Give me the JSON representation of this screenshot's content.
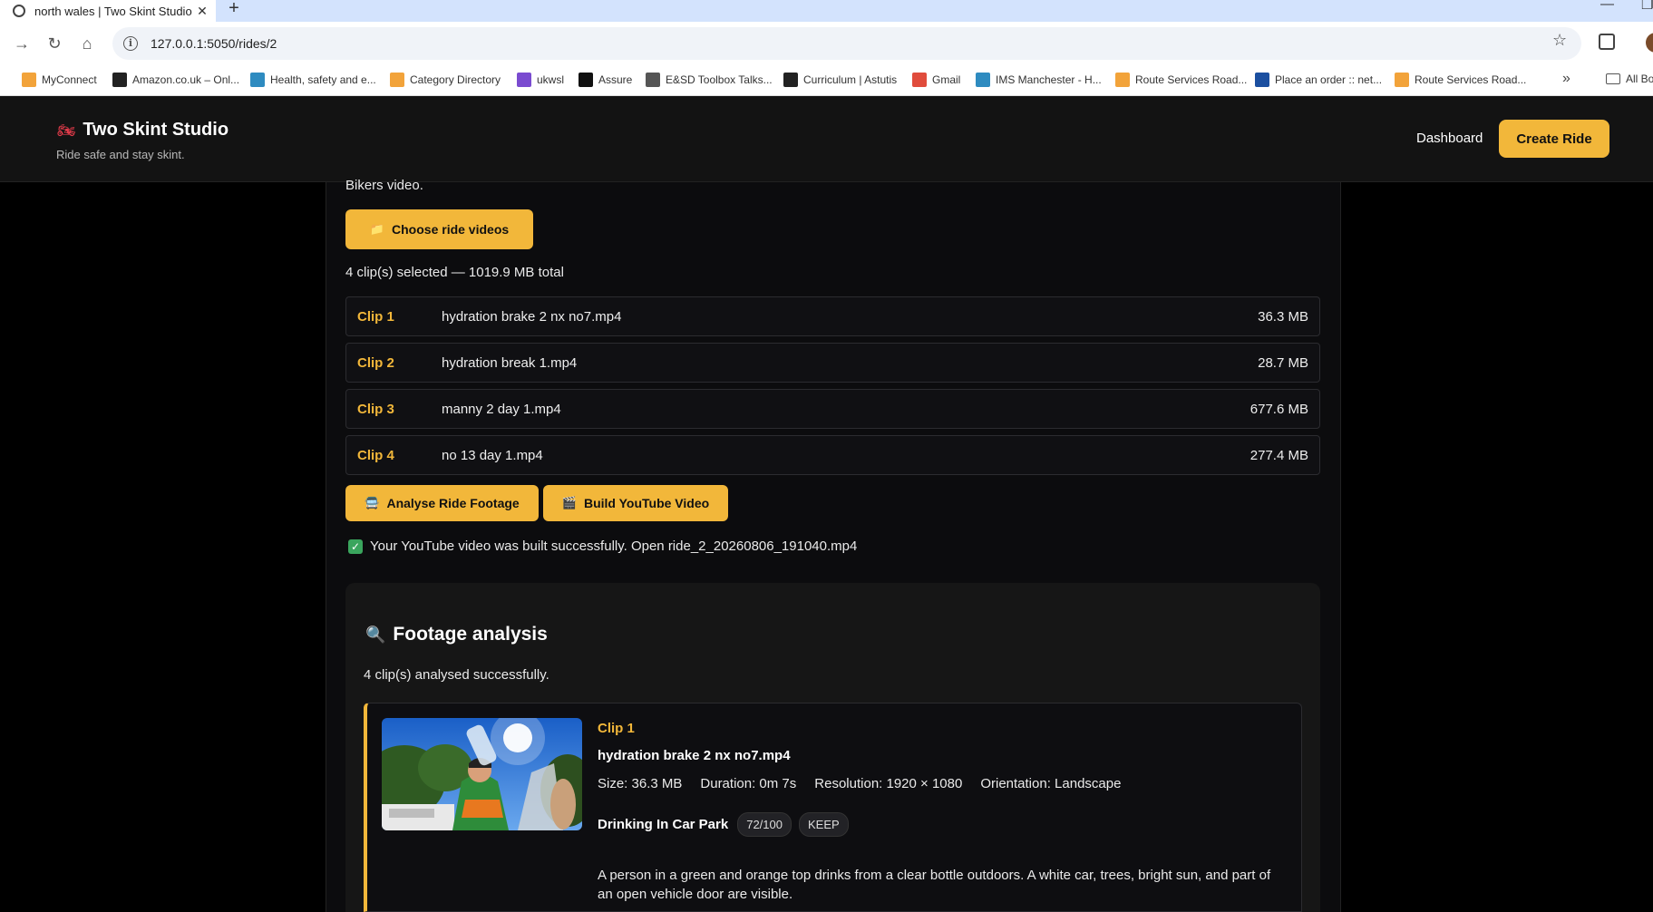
{
  "browser": {
    "tab_title": "north wales | Two Skint Studio",
    "url": "127.0.0.1:5050/rides/2",
    "bookmarks": [
      {
        "label": "MyConnect",
        "color": "#f2a33a"
      },
      {
        "label": "Amazon.co.uk – Onl...",
        "color": "#222222"
      },
      {
        "label": "Health, safety and e...",
        "color": "#2e8bc0"
      },
      {
        "label": "Category Directory",
        "color": "#f2a33a"
      },
      {
        "label": "ukwsl",
        "color": "#7a4bd0"
      },
      {
        "label": "Assure",
        "color": "#111111"
      },
      {
        "label": "E&SD Toolbox Talks...",
        "color": "#555555"
      },
      {
        "label": "Curriculum | Astutis",
        "color": "#222222"
      },
      {
        "label": "Gmail",
        "color": "#e04c3c"
      },
      {
        "label": "IMS Manchester - H...",
        "color": "#2e8bc0"
      },
      {
        "label": "Route Services Road...",
        "color": "#f2a33a"
      },
      {
        "label": "Place an order :: net...",
        "color": "#1b4fa0"
      },
      {
        "label": "Route Services Road...",
        "color": "#f2a33a"
      }
    ],
    "more_label": "»",
    "all_bookmarks_label": "All Bo"
  },
  "app": {
    "brand_icon": "🏍",
    "title": "Two Skint Studio",
    "tagline": "Ride safe and stay skint.",
    "nav_dashboard": "Dashboard",
    "create_ride": "Create Ride"
  },
  "upload": {
    "cut_text": "Bikers video.",
    "choose_emoji": "📁",
    "choose_label": "Choose ride videos",
    "summary": "4 clip(s) selected — 1019.9 MB total",
    "clips": [
      {
        "label": "Clip 1",
        "name": "hydration brake 2 nx no7.mp4",
        "size": "36.3 MB"
      },
      {
        "label": "Clip 2",
        "name": "hydration break 1.mp4",
        "size": "28.7 MB"
      },
      {
        "label": "Clip 3",
        "name": "manny 2 day 1.mp4",
        "size": "677.6 MB"
      },
      {
        "label": "Clip 4",
        "name": "no 13 day 1.mp4",
        "size": "277.4 MB"
      }
    ],
    "analyse_emoji": "🚍",
    "analyse_label": "Analyse Ride Footage",
    "build_emoji": "🎬",
    "build_label": "Build YouTube Video",
    "success_check": "✓",
    "success_text": "Your YouTube video was built successfully. Open ride_2_20260806_191040.mp4"
  },
  "analysis": {
    "icon": "🔍",
    "title": "Footage analysis",
    "summary": "4 clip(s) analysed successfully.",
    "card": {
      "clip_label": "Clip 1",
      "file": "hydration brake 2 nx no7.mp4",
      "size": "Size: 36.3 MB",
      "duration": "Duration: 0m 7s",
      "resolution": "Resolution: 1920 × 1080",
      "orientation": "Orientation: Landscape",
      "scene": "Drinking In Car Park",
      "score": "72/100",
      "verdict": "KEEP",
      "description": "A person in a green and orange top drinks from a clear bottle outdoors. A white car, trees, bright sun, and part of an open vehicle door are visible."
    }
  },
  "colors": {
    "accent": "#f2b73a",
    "background": "#000000",
    "panel": "#0c0c0e",
    "success": "#3aa55d"
  }
}
